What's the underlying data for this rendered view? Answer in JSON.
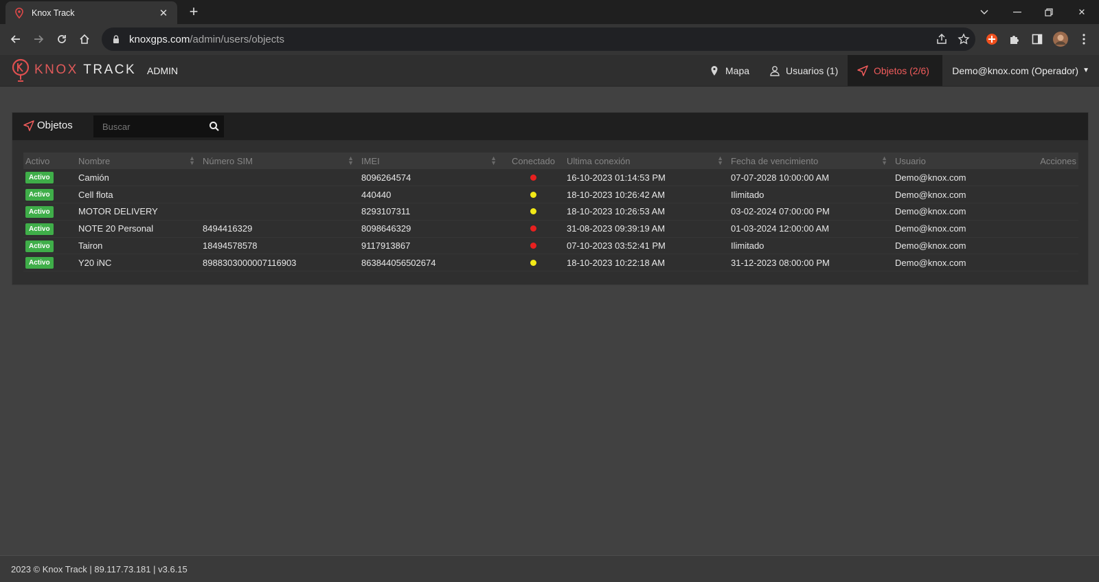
{
  "browser": {
    "tab_title": "Knox Track",
    "url_host": "knoxgps.com",
    "url_path": "/admin/users/objects"
  },
  "app": {
    "brand_bold": "KNOX",
    "brand_light": " TRACK",
    "section": "ADMIN",
    "nav": {
      "map_label": "Mapa",
      "users_label": "Usuarios (1)",
      "objects_label": "Objetos (2/6)",
      "user_menu": "Demo@knox.com (Operador)"
    },
    "accent_color": "#f25c5c"
  },
  "panel": {
    "title": "Objetos",
    "search_placeholder": "Buscar"
  },
  "table": {
    "columns": [
      "Activo",
      "Nombre",
      "Número SIM",
      "IMEI",
      "Conectado",
      "Ultima conexión",
      "Fecha de vencimiento",
      "Usuario",
      "Acciones"
    ],
    "rows": [
      {
        "status": "Activo",
        "name": "Camión",
        "sim": "",
        "imei": "8096264574",
        "connected": "red",
        "last": "16-10-2023 01:14:53 PM",
        "expiry": "07-07-2028 10:00:00 AM",
        "user": "Demo@knox.com"
      },
      {
        "status": "Activo",
        "name": "Cell flota",
        "sim": "",
        "imei": "440440",
        "connected": "yellow",
        "last": "18-10-2023 10:26:42 AM",
        "expiry": "Ilimitado",
        "user": "Demo@knox.com"
      },
      {
        "status": "Activo",
        "name": "MOTOR DELIVERY",
        "sim": "",
        "imei": "8293107311",
        "connected": "yellow",
        "last": "18-10-2023 10:26:53 AM",
        "expiry": "03-02-2024 07:00:00 PM",
        "user": "Demo@knox.com"
      },
      {
        "status": "Activo",
        "name": "NOTE 20 Personal",
        "sim": "8494416329",
        "imei": "8098646329",
        "connected": "red",
        "last": "31-08-2023 09:39:19 AM",
        "expiry": "01-03-2024 12:00:00 AM",
        "user": "Demo@knox.com"
      },
      {
        "status": "Activo",
        "name": "Tairon",
        "sim": "18494578578",
        "imei": "9117913867",
        "connected": "red",
        "last": "07-10-2023 03:52:41 PM",
        "expiry": "Ilimitado",
        "user": "Demo@knox.com"
      },
      {
        "status": "Activo",
        "name": "Y20 iNC",
        "sim": "8988303000007116903",
        "imei": "863844056502674",
        "connected": "yellow",
        "last": "18-10-2023 10:22:18 AM",
        "expiry": "31-12-2023 08:00:00 PM",
        "user": "Demo@knox.com"
      }
    ],
    "dot_colors": {
      "red": "#e8201f",
      "yellow": "#f2e917"
    }
  },
  "footer": {
    "text": "2023 © Knox Track | 89.117.73.181 | v3.6.15"
  }
}
